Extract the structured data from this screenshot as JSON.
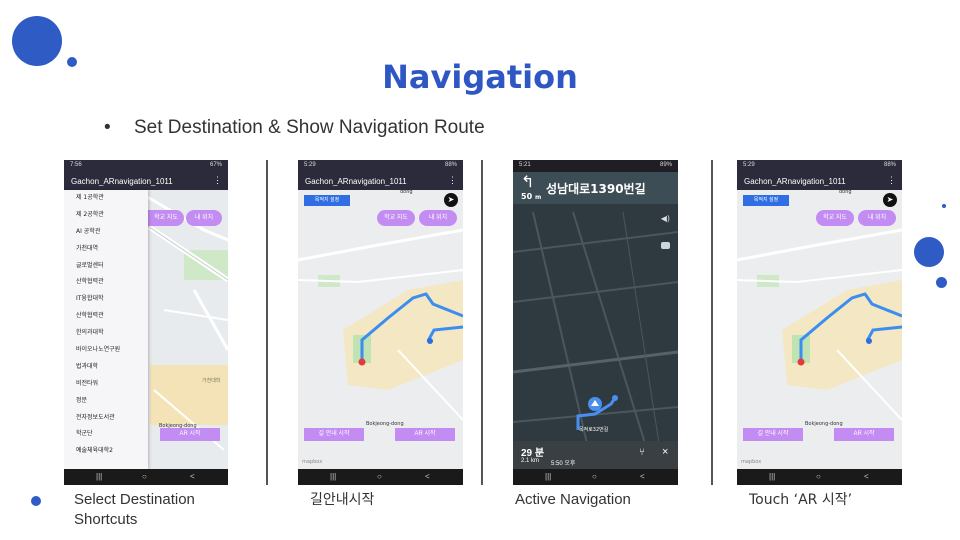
{
  "slide": {
    "title": "Navigation",
    "bullet": "Set Destination & Show Navigation Route",
    "bullet_marker": "•",
    "captions": [
      "Select Destination Shortcuts",
      "길안내시작",
      "Active Navigation",
      "Touch ‘AR 시작’"
    ],
    "caption1_line1": "Select Destination",
    "caption1_line2": "Shortcuts",
    "accent_color": "#2e5cc4"
  },
  "phone1": {
    "status_time": "7:56",
    "status_right": "67%",
    "app_title": "Gachon_ARnavigation_1011",
    "menu_icon": "⋮",
    "menu_items": [
      "제 1공학관",
      "제 2공학관",
      "AI 공학관",
      "가천대역",
      "글로벌센터",
      "산학협력관",
      "IT융합대학",
      "산학협력관",
      "한의과대학",
      "바이오나노연구원",
      "법과대학",
      "비전타워",
      "정문",
      "전자정보도서관",
      "학군단",
      "예술체육대학2"
    ],
    "btn_school_map": "학교 지도",
    "btn_my_location": "내 위치",
    "btn_ar_start": "AR 시작",
    "map_labels": [
      "가천대학",
      "Bokjeong-dong"
    ]
  },
  "phone2": {
    "status_time": "5:29",
    "status_right": "88%",
    "app_title": "Gachon_ARnavigation_1011",
    "menu_icon": "⋮",
    "btn_set_destination": "목적지 설정",
    "btn_school_map": "학교 지도",
    "btn_my_location": "내 위치",
    "btn_route_start": "길 안내 시작",
    "btn_ar_start": "AR 시작",
    "map_labels": [
      "dong",
      "Bokjeong-dong"
    ],
    "map_credit": "mapbox"
  },
  "phone3": {
    "status_time": "5:21",
    "status_right": "89%",
    "turn_icon": "↰",
    "distance": "50",
    "distance_unit": "m",
    "street": "성남대로1390번길",
    "eta_minutes": "29 분",
    "trip_distance": "2.1 km",
    "arrival": "5:50 오후",
    "destination_label": "목적로32번길",
    "close_icon": "×",
    "route_icon": "⑂"
  },
  "phone4": {
    "status_time": "5:29",
    "status_right": "88%",
    "app_title": "Gachon_ARnavigation_1011",
    "menu_icon": "⋮",
    "btn_set_destination": "목적지 설정",
    "btn_school_map": "학교 지도",
    "btn_my_location": "내 위치",
    "btn_route_start": "길 안내 시작",
    "btn_ar_start": "AR 시작",
    "map_labels": [
      "dong",
      "Bokjeong-dong"
    ],
    "map_credit": "mapbox"
  },
  "nav": {
    "recents": "|||",
    "home": "○",
    "back": "<"
  }
}
